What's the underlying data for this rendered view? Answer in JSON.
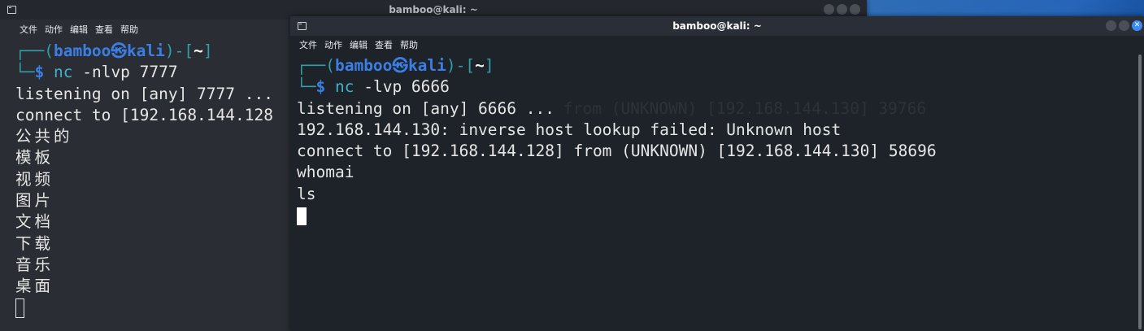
{
  "back_window": {
    "title": "bamboo@kali: ~",
    "menu": [
      "文件",
      "动作",
      "编辑",
      "查看",
      "帮助"
    ],
    "prompt": {
      "open": "┌──(",
      "user": "bamboo",
      "at": "㉿",
      "host": "kali",
      "close": ")-[",
      "dir": "~",
      "end": "]",
      "lead": "└─",
      "dollar": "$"
    },
    "command": {
      "name": "nc",
      "args": "-nlvp 7777"
    },
    "output": [
      "listening on [any] 7777 ...",
      "connect to [192.168.144.128",
      "公共的",
      "模板",
      "视频",
      "图片",
      "文档",
      "下载",
      "音乐",
      "桌面"
    ],
    "hidden_text": "from (UNKNOWN) [192.168.144.130] 39766"
  },
  "front_window": {
    "title": "bamboo@kali: ~",
    "menu": [
      "文件",
      "动作",
      "编辑",
      "查看",
      "帮助"
    ],
    "prompt": {
      "open": "┌──(",
      "user": "bamboo",
      "at": "㉿",
      "host": "kali",
      "close": ")-[",
      "dir": "~",
      "end": "]",
      "lead": "└─",
      "dollar": "$"
    },
    "command": {
      "name": "nc",
      "args": "-lvp 6666"
    },
    "output": [
      "listening on [any] 6666 ...",
      "192.168.144.130: inverse host lookup failed: Unknown host",
      "connect to [192.168.144.128] from (UNKNOWN) [192.168.144.130] 58696",
      "whomai",
      "ls"
    ]
  },
  "colors": {
    "prompt_bracket": "#2fa0a7",
    "prompt_user": "#3b7fe6",
    "command": "#3fb4c9",
    "text": "#e6e6e6"
  },
  "icons": {
    "terminal": "terminal-icon",
    "close": "close-icon"
  }
}
